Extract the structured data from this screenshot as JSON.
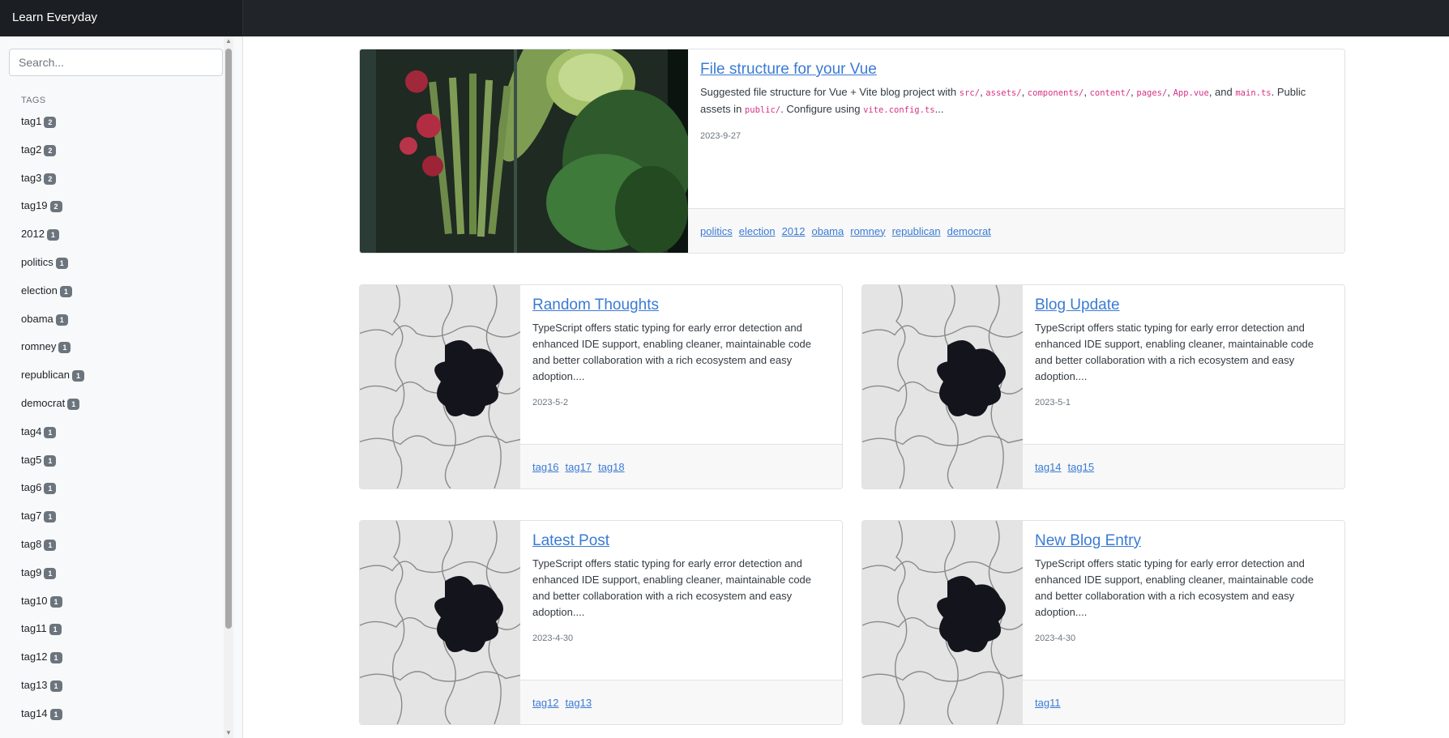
{
  "navbar": {
    "brand": "Learn Everyday"
  },
  "sidebar": {
    "search_placeholder": "Search...",
    "tags_heading": "TAGS",
    "tags": [
      {
        "label": "tag1",
        "count": "2"
      },
      {
        "label": "tag2",
        "count": "2"
      },
      {
        "label": "tag3",
        "count": "2"
      },
      {
        "label": "tag19",
        "count": "2"
      },
      {
        "label": "2012",
        "count": "1"
      },
      {
        "label": "politics",
        "count": "1"
      },
      {
        "label": "election",
        "count": "1"
      },
      {
        "label": "obama",
        "count": "1"
      },
      {
        "label": "romney",
        "count": "1"
      },
      {
        "label": "republican",
        "count": "1"
      },
      {
        "label": "democrat",
        "count": "1"
      },
      {
        "label": "tag4",
        "count": "1"
      },
      {
        "label": "tag5",
        "count": "1"
      },
      {
        "label": "tag6",
        "count": "1"
      },
      {
        "label": "tag7",
        "count": "1"
      },
      {
        "label": "tag8",
        "count": "1"
      },
      {
        "label": "tag9",
        "count": "1"
      },
      {
        "label": "tag10",
        "count": "1"
      },
      {
        "label": "tag11",
        "count": "1"
      },
      {
        "label": "tag12",
        "count": "1"
      },
      {
        "label": "tag13",
        "count": "1"
      },
      {
        "label": "tag14",
        "count": "1"
      }
    ]
  },
  "featured": {
    "title": "File structure for your Vue",
    "excerpt": {
      "t1": "Suggested file structure for Vue + Vite blog project with ",
      "c1": "src/",
      "s1": ", ",
      "c2": "assets/",
      "s2": ", ",
      "c3": "components/",
      "s3": ", ",
      "c4": "content/",
      "s4": ", ",
      "c5": "pages/",
      "s5": ", ",
      "c6": "App.vue",
      "s6": ", and ",
      "c7": "main.ts",
      "s7": ". Public assets in ",
      "c8": "public/",
      "s8": ". Configure using ",
      "c9": "vite.config.ts",
      "s9": "..."
    },
    "date": "2023-9-27",
    "tags": [
      "politics",
      "election",
      "2012",
      "obama",
      "romney",
      "republican",
      "democrat"
    ]
  },
  "posts": [
    {
      "title": "Random Thoughts",
      "excerpt": "TypeScript offers static typing for early error detection and enhanced IDE support, enabling cleaner, maintainable code and better collaboration with a rich ecosystem and easy adoption....",
      "date": "2023-5-2",
      "tags": [
        "tag16",
        "tag17",
        "tag18"
      ]
    },
    {
      "title": "Blog Update",
      "excerpt": "TypeScript offers static typing for early error detection and enhanced IDE support, enabling cleaner, maintainable code and better collaboration with a rich ecosystem and easy adoption....",
      "date": "2023-5-1",
      "tags": [
        "tag14",
        "tag15"
      ]
    },
    {
      "title": "Latest Post",
      "excerpt": "TypeScript offers static typing for early error detection and enhanced IDE support, enabling cleaner, maintainable code and better collaboration with a rich ecosystem and easy adoption....",
      "date": "2023-4-30",
      "tags": [
        "tag12",
        "tag13"
      ]
    },
    {
      "title": "New Blog Entry",
      "excerpt": "TypeScript offers static typing for early error detection and enhanced IDE support, enabling cleaner, maintainable code and better collaboration with a rich ecosystem and easy adoption....",
      "date": "2023-4-30",
      "tags": [
        "tag11"
      ]
    }
  ],
  "colors": {
    "navbar": "#212529",
    "link": "#3a7bd5",
    "badge": "#6c757d",
    "code": "#d63384"
  }
}
